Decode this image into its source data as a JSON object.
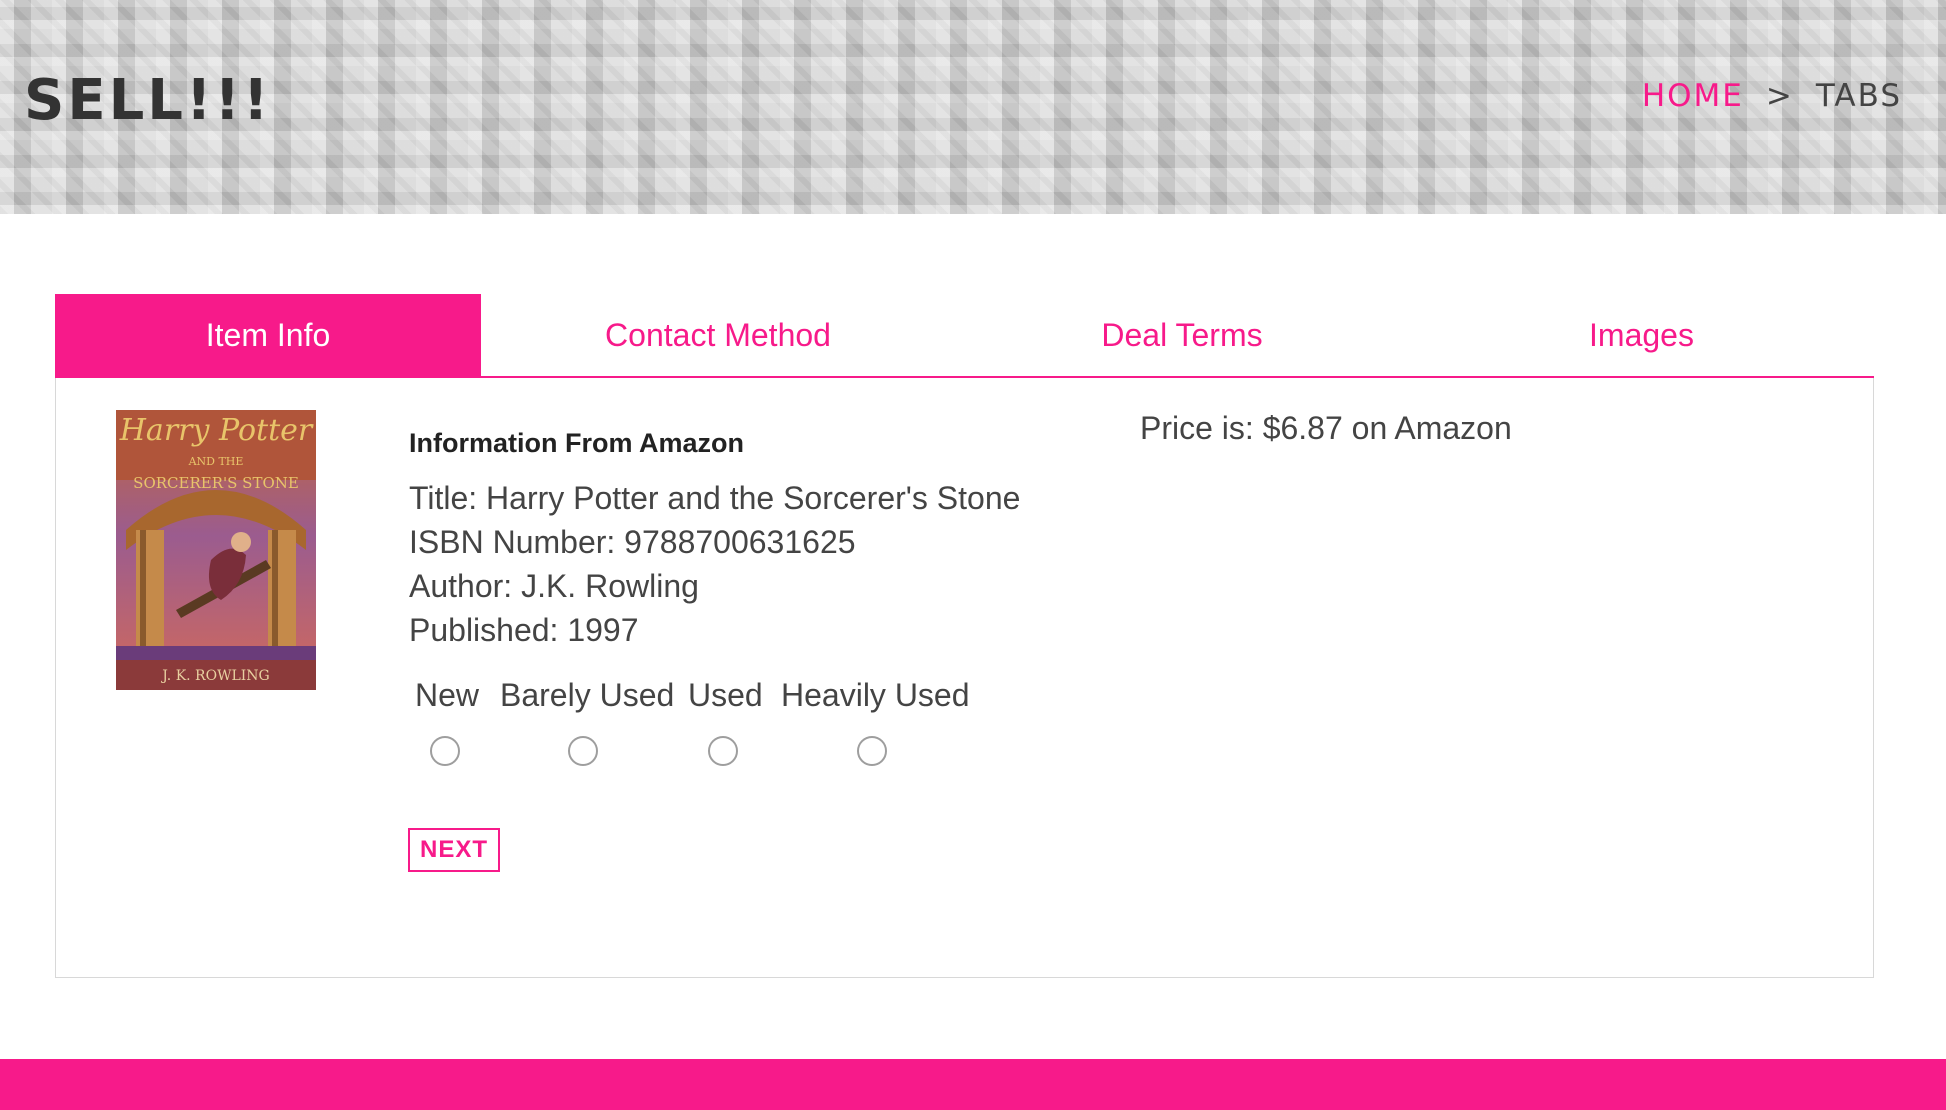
{
  "header": {
    "logo": "SELL!!!",
    "breadcrumb": {
      "home": "HOME",
      "separator": ">",
      "current": "TABS"
    }
  },
  "tabs": [
    {
      "label": "Item Info",
      "active": true
    },
    {
      "label": "Contact Method",
      "active": false
    },
    {
      "label": "Deal Terms",
      "active": false
    },
    {
      "label": "Images",
      "active": false
    }
  ],
  "item": {
    "cover": {
      "alt": "book-cover-image",
      "title_art": "Harry Potter",
      "subtitle_art": "AND THE",
      "subtitle2_art": "SORCERER'S STONE",
      "author_art": "J. K. ROWLING"
    },
    "heading": "Information From Amazon",
    "title_line": "Title: Harry Potter and the Sorcerer's Stone",
    "isbn_line": "ISBN Number: 9788700631625",
    "author_line": "Author: J.K. Rowling",
    "published_line": "Published: 1997",
    "price_line": "Price is: $6.87 on Amazon",
    "conditions": [
      {
        "label": "New",
        "selected": false
      },
      {
        "label": "Barely Used",
        "selected": false
      },
      {
        "label": "Used",
        "selected": false
      },
      {
        "label": "Heavily Used",
        "selected": false
      }
    ],
    "next_label": "NEXT"
  },
  "colors": {
    "accent": "#f71a8a",
    "text": "#444444",
    "panel_border": "#d8d8d8"
  }
}
